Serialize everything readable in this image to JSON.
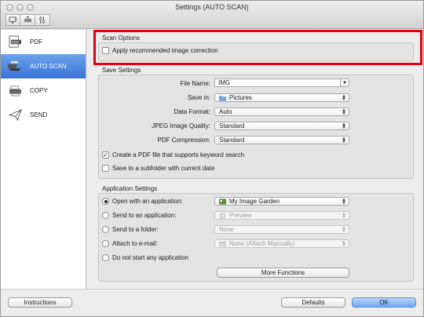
{
  "window": {
    "title": "Settings (AUTO SCAN)"
  },
  "toolbar": {
    "icons": [
      "scan-from-computer-icon",
      "scan-from-panel-icon",
      "general-settings-icon"
    ]
  },
  "sidebar": {
    "items": [
      {
        "label": "PDF",
        "icon": "pdf-icon",
        "selected": false
      },
      {
        "label": "AUTO SCAN",
        "icon": "auto-scan-icon",
        "selected": true
      },
      {
        "label": "COPY",
        "icon": "copy-icon",
        "selected": false
      },
      {
        "label": "SEND",
        "icon": "send-icon",
        "selected": false
      }
    ]
  },
  "scan_options": {
    "title": "Scan Options",
    "apply_correction": {
      "label": "Apply recommended image correction",
      "checked": false
    }
  },
  "save_settings": {
    "title": "Save Settings",
    "file_name": {
      "label": "File Name:",
      "value": "IMG"
    },
    "save_in": {
      "label": "Save in:",
      "value": "Pictures",
      "icon": "folder-icon"
    },
    "data_format": {
      "label": "Data Format:",
      "value": "Auto"
    },
    "jpeg_quality": {
      "label": "JPEG Image Quality:",
      "value": "Standard"
    },
    "pdf_compression": {
      "label": "PDF Compression:",
      "value": "Standard"
    },
    "keyword_pdf": {
      "label": "Create a PDF file that supports keyword search",
      "checked": true
    },
    "subfolder": {
      "label": "Save to a subfolder with current date",
      "checked": false
    }
  },
  "app_settings": {
    "title": "Application Settings",
    "open_app": {
      "label": "Open with an application:",
      "selected": true,
      "value": "My Image Garden"
    },
    "send_app": {
      "label": "Send to an application:",
      "selected": false,
      "value": "Preview"
    },
    "send_folder": {
      "label": "Send to a folder:",
      "selected": false,
      "value": "None"
    },
    "attach_email": {
      "label": "Attach to e-mail:",
      "selected": false,
      "value": "None (Attach Manually)"
    },
    "no_app": {
      "label": "Do not start any application",
      "selected": false
    },
    "more_functions": "More Functions"
  },
  "footer": {
    "instructions": "Instructions",
    "defaults": "Defaults",
    "ok": "OK"
  },
  "colors": {
    "highlight": "#e60012",
    "selection": "#3a74d6",
    "primary_button": "#6ea7ef"
  }
}
